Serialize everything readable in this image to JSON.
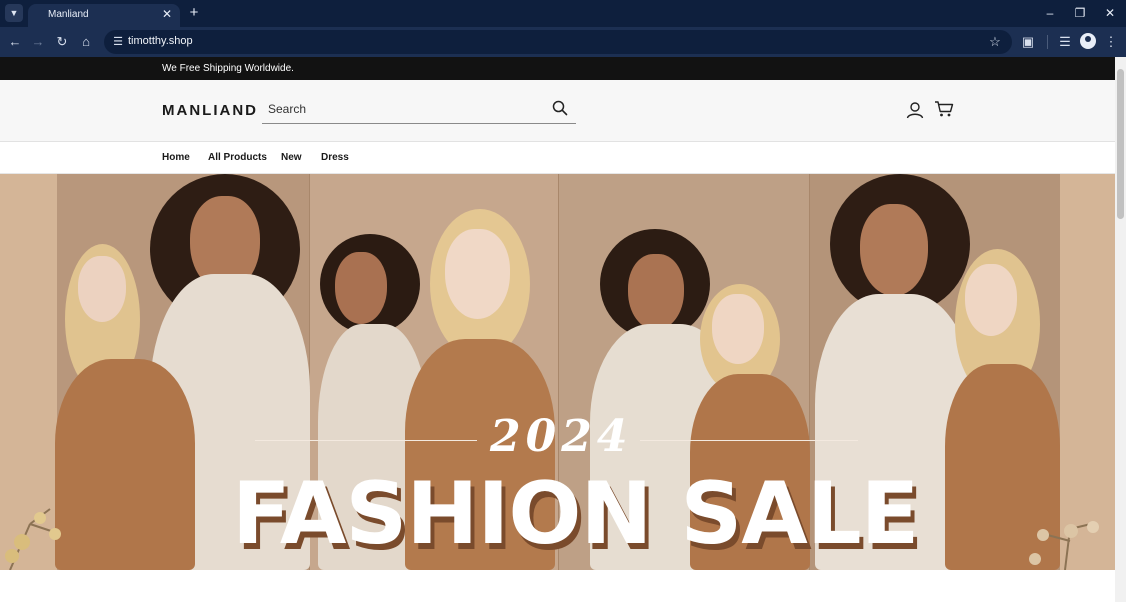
{
  "browser": {
    "tab_title": "Manliand",
    "url": "timotthy.shop",
    "icons": {
      "tab_search": "chevron-down-icon",
      "tab_close": "close-icon",
      "new_tab": "plus-icon",
      "back": "back-arrow-icon",
      "forward": "forward-arrow-icon",
      "reload": "reload-icon",
      "home": "home-icon",
      "site_info": "tune-icon",
      "bookmark": "star-icon",
      "extensions": "puzzle-icon",
      "media": "media-control-icon",
      "profile": "profile-icon",
      "menu": "kebab-menu-icon",
      "minimize": "minimize-icon",
      "restore": "restore-icon",
      "close": "close-icon"
    }
  },
  "site": {
    "announcement": "We Free Shipping Worldwide.",
    "logo": "MANLIAND",
    "search": {
      "placeholder": "Search",
      "value": ""
    },
    "nav": [
      {
        "label": "Home"
      },
      {
        "label": "All Products"
      },
      {
        "label": "New"
      },
      {
        "label": "Dress"
      }
    ],
    "hero": {
      "year": "2024",
      "title": "FASHION SALE"
    }
  },
  "colors": {
    "browser_frame": "#0e1f3d",
    "browser_toolbar": "#1c2f52",
    "announcement_bg": "#121212",
    "header_bg": "#f7f7f7",
    "hero_bg": "#c9a98d",
    "camel_coat": "#b0764a",
    "cream_coat": "#e6dcd0",
    "title_shadow": "#7a4b2c"
  }
}
